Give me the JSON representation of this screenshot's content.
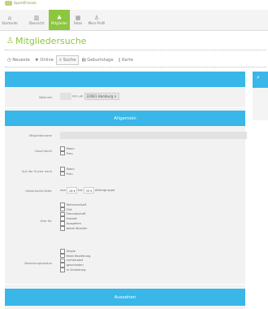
{
  "logo": {
    "text": "Sport4Friends"
  },
  "nav": [
    {
      "icon": "⌂",
      "label": "Startseite"
    },
    {
      "icon": "▥",
      "label": "Übersicht"
    },
    {
      "icon": "♣",
      "label": "Mitglieder"
    },
    {
      "icon": "▦",
      "label": "Fotos"
    },
    {
      "icon": "♙",
      "label": "Mein Profil"
    }
  ],
  "page_title": "Mitgliedersuche",
  "tabs": [
    {
      "icon": "◷",
      "label": "Neueste"
    },
    {
      "icon": "★",
      "label": "Online"
    },
    {
      "icon": "⌕",
      "label": "Suche"
    },
    {
      "icon": "▤",
      "label": "Geburtstage"
    },
    {
      "icon": "▯",
      "label": "Karte"
    }
  ],
  "form": {
    "wohnort": {
      "label": "Wohnort",
      "prefix": "km um",
      "value": "22081 Hamburg",
      "remove": "×"
    },
    "section_allgemein": "Allgemein",
    "mitgliedsname": {
      "label": "Mitgliedsname",
      "value": ""
    },
    "geschlecht": {
      "label": "Geschlecht",
      "options": [
        "Mann",
        "Frau"
      ]
    },
    "suche_nach": {
      "label": "Auf der Suche nach",
      "options": [
        "Mann",
        "Frau"
      ]
    },
    "geburtsjahr": {
      "label": "Geburtsjahr/Alter",
      "from_word": "von",
      "from": "18",
      "to_word": "bis",
      "to": "35",
      "suffix": "Altersgruppe"
    },
    "hier_fuer": {
      "label": "Hier für",
      "options": [
        "Partnerschaft",
        "Flirt",
        "Freundschaft",
        "Freizeit",
        "Ausgehen",
        "beide Wunder"
      ]
    },
    "beziehungsstatus": {
      "label": "Beziehungsstatus",
      "options": [
        "Single",
        "feste Beziehung",
        "verheiratet",
        "geschieden",
        "in Scheidung"
      ]
    },
    "section_aussehen": "Aussehen"
  },
  "side": {
    "icon": "⌕"
  },
  "colors": {
    "accent": "#8dc63f",
    "bar": "#39b7e8"
  }
}
